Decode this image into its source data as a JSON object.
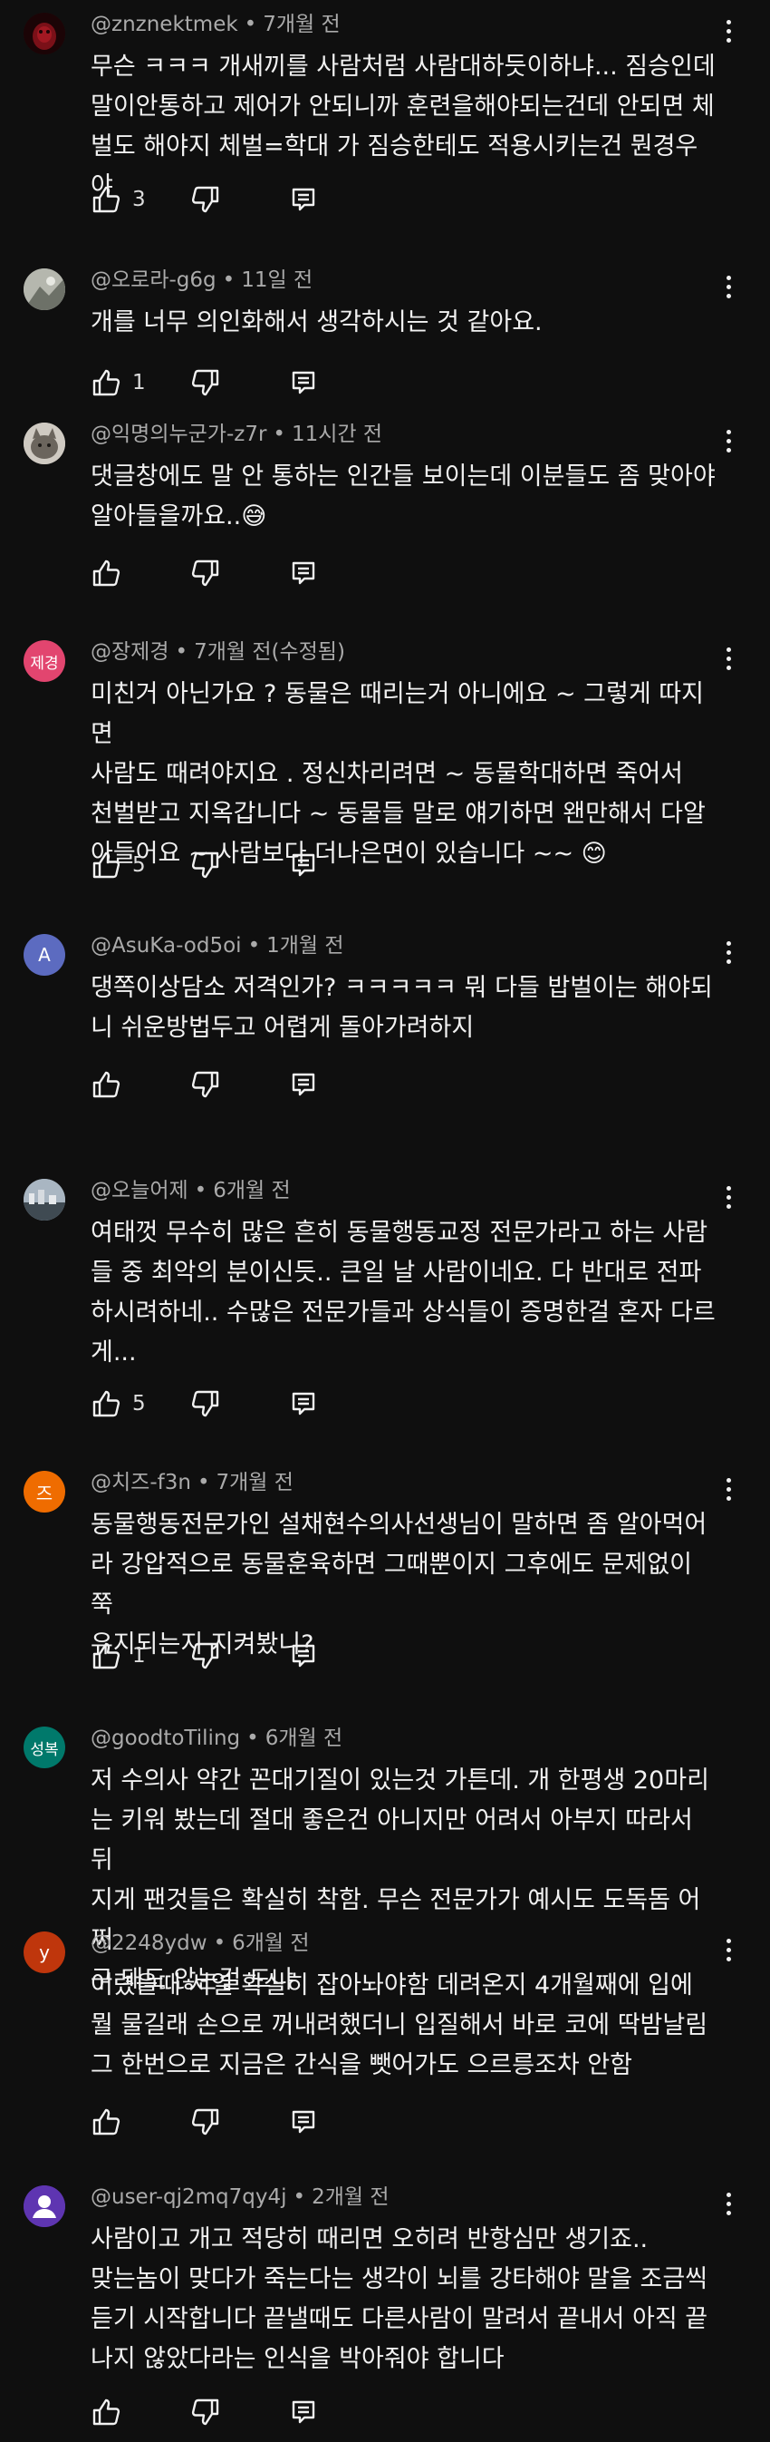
{
  "comments": [
    {
      "avatar_text": "",
      "avatar_color": "#5a0f14",
      "username": "@znznektmek",
      "time": "7개월 전",
      "text": "무슨 ㅋㅋㅋ 개새끼를 사람처럼 사람대하듯이하냐... 짐승인데\n말이안통하고 제어가 안되니까 훈련을해야되는건데 안되면 체\n벌도 해야지 체벌=학대 가 짐승한테도 적용시키는건 뭔경우야",
      "likes": "3"
    },
    {
      "avatar_text": "",
      "avatar_color": "#8a8f86",
      "username": "@오로라-g6g",
      "time": "11일 전",
      "text": "개를 너무 의인화해서 생각하시는 것 같아요.",
      "likes": "1"
    },
    {
      "avatar_text": "",
      "avatar_color": "#9c9891",
      "username": "@익명의누군가-z7r",
      "time": "11시간 전",
      "text": "댓글창에도 말 안 통하는 인간들 보이는데 이분들도 좀 맞아야\n알아들을까요..😅",
      "likes": ""
    },
    {
      "avatar_text": "제경",
      "avatar_color": "#e2456f",
      "username": "@장제경",
      "time": "7개월 전(수정됨)",
      "text": "미친거 아닌가요 ? 동물은 때리는거 아니에요 ~ 그렇게 따지면\n사람도 때려야지요 .  정신차리려면 ~   동물학대하면 죽어서\n천벌받고 지옥갑니다 ~  동물들 말로 얘기하면 왠만해서 다알\n아들어요 ~ 사람보다 더나은면이 있습니다 ~~ 😊",
      "likes": "5"
    },
    {
      "avatar_text": "A",
      "avatar_color": "#5c6bc0",
      "username": "@AsuKa-od5oi",
      "time": "1개월 전",
      "text": "댕쪽이상담소 저격인가? ㅋㅋㅋㅋㅋ 뭐 다들 밥벌이는 해야되\n니 쉬운방법두고 어렵게 돌아가려하지",
      "likes": ""
    },
    {
      "avatar_text": "",
      "avatar_color": "#6f7d8a",
      "username": "@오늘어제",
      "time": "6개월 전",
      "text": "여태껏 무수히 많은 흔히 동물행동교정 전문가라고 하는 사람\n들 중 최악의 분이신듯..  큰일 날 사람이네요.  다 반대로 전파\n하시려하네.. 수많은 전문가들과 상식들이 증명한걸 혼자 다르\n게...",
      "likes": "5"
    },
    {
      "avatar_text": "즈",
      "avatar_color": "#ef6c00",
      "username": "@치즈-f3n",
      "time": "7개월 전",
      "text": "동물행동전문가인 설채현수의사선생님이 말하면 좀 알아먹어\n라 강압적으로 동물훈육하면 그때뿐이지 그후에도 문제없이 쭉\n유지되는지 지켜봤니?",
      "likes": "1"
    },
    {
      "avatar_text": "성복",
      "avatar_color": "#00796b",
      "username": "@goodtoTiling",
      "time": "6개월 전",
      "text": "저 수의사 약간 꼰대기질이 있는것 가튼데. 개 한평생 20마리\n는 키워 봤는데 절대 좋은건 아니지만 어려서 아부지 따라서 뒤\n지게 팬것들은 확실히 착함. 무슨 전문가가 예시도 도독돔 어쩌\n구 돼도 않는걸 드냐",
      "likes": ""
    },
    {
      "avatar_text": "y",
      "avatar_color": "#bf360c",
      "username": "@2248ydw",
      "time": "6개월 전",
      "text": "어렸을때 서열 확실히 잡아놔야함 데려온지 4개월째에 입에\n뭘 물길래 손으로 꺼내려했더니 입질해서 바로 코에 딱밤날림\n그 한번으로 지금은 간식을 뺏어가도 으르릉조차 안함",
      "likes": ""
    },
    {
      "avatar_text": "",
      "avatar_color": "#5e35b1",
      "username": "@user-qj2mq7qy4j",
      "time": "2개월 전",
      "text": "사람이고 개고 적당히 때리면 오히려 반항심만 생기죠..\n맞는놈이 맞다가 죽는다는 생각이 뇌를 강타해야 말을 조금씩\n듣기 시작합니다 끝낼때도 다른사람이 말려서 끝내서 아직 끝\n나지 않았다라는 인식을 박아줘야 합니다",
      "likes": ""
    }
  ]
}
